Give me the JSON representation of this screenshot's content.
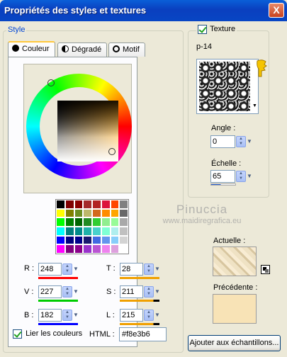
{
  "window": {
    "title": "Propriétés des styles et textures",
    "close_label": "X"
  },
  "style_group": {
    "legend": "Style"
  },
  "tabs": [
    {
      "label": "Couleur",
      "active": true
    },
    {
      "label": "Dégradé",
      "active": false
    },
    {
      "label": "Motif",
      "active": false
    }
  ],
  "selected_color": "#f8e3b6",
  "palette": [
    "#000000",
    "#800000",
    "#8b0000",
    "#a52a2a",
    "#b22222",
    "#dc143c",
    "#ff4500",
    "#808080",
    "#ffff00",
    "#808000",
    "#6b8e23",
    "#bdb76b",
    "#d2691e",
    "#ff8c00",
    "#ffa500",
    "#696969",
    "#00ff00",
    "#008000",
    "#006400",
    "#228b22",
    "#32cd32",
    "#90ee90",
    "#98fb98",
    "#a9a9a9",
    "#00ffff",
    "#008080",
    "#008b8b",
    "#20b2aa",
    "#48d1cc",
    "#7fffd4",
    "#afeeee",
    "#c0c0c0",
    "#0000ff",
    "#000080",
    "#00008b",
    "#191970",
    "#4169e1",
    "#6495ed",
    "#87cefa",
    "#d3d3d3",
    "#ff00ff",
    "#800080",
    "#8b008b",
    "#9932cc",
    "#ba55d3",
    "#ee82ee",
    "#dda0dd",
    "#ffffff"
  ],
  "rgb": {
    "r_label": "R :",
    "r": "248",
    "g_label": "V :",
    "g": "227",
    "b_label": "B :",
    "b": "182"
  },
  "hsl": {
    "t_label": "T :",
    "t": "28",
    "s_label": "S :",
    "s": "211",
    "l_label": "L :",
    "l": "215"
  },
  "link_colors_label": "Lier les couleurs",
  "html_label": "HTML :",
  "html_value": "#f8e3b6",
  "texture": {
    "checkbox_label": "Texture",
    "name": "p-14",
    "angle_label": "Angle :",
    "angle": "0",
    "scale_label": "Échelle :",
    "scale": "65"
  },
  "actuelle_label": "Actuelle :",
  "precedente_label": "Précédente :",
  "add_button_label": "Ajouter aux échantillons...",
  "watermark": {
    "line1": "Pinuccia",
    "line2": "www.maidiregrafica.eu"
  }
}
